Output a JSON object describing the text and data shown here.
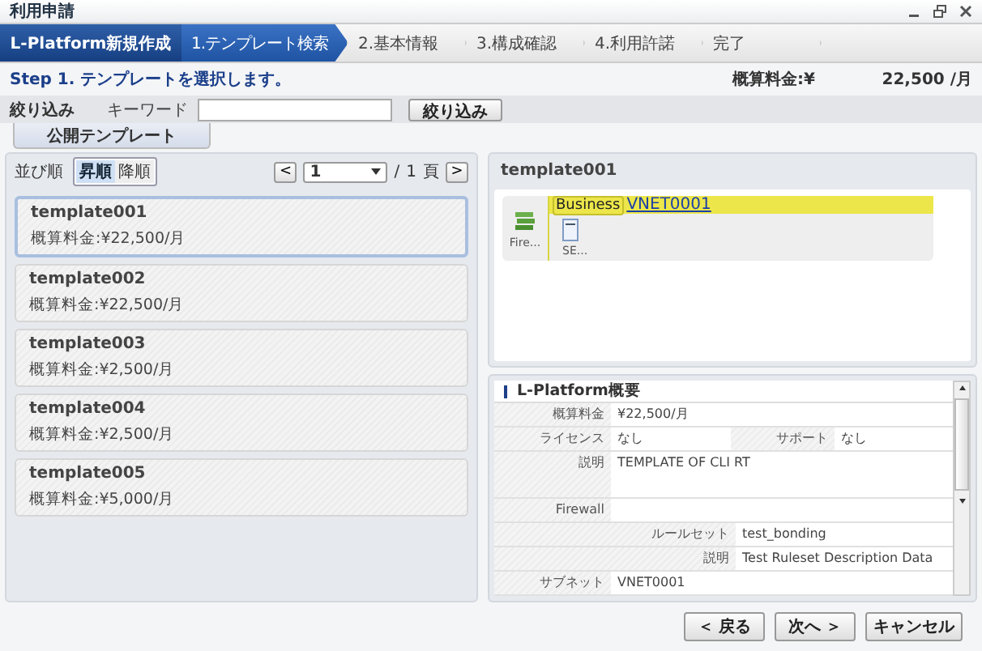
{
  "window": {
    "title": "利用申請"
  },
  "wizard": {
    "title": "L-Platform新規作成",
    "steps": [
      {
        "label": "1.テンプレート検索",
        "selected": true
      },
      {
        "label": "2.基本情報",
        "selected": false
      },
      {
        "label": "3.構成確認",
        "selected": false
      },
      {
        "label": "4.利用許諾",
        "selected": false
      },
      {
        "label": "完了",
        "selected": false
      }
    ]
  },
  "step_header": {
    "instruction": "Step 1. テンプレートを選択します。",
    "price_label": "概算料金:¥",
    "price_value": "22,500 /月"
  },
  "filter": {
    "label": "絞り込み",
    "keyword_label": "キーワード",
    "button": "絞り込み"
  },
  "tabs": [
    {
      "label": "公開テンプレート",
      "selected": true
    }
  ],
  "list_panel": {
    "sort_label": "並び順",
    "sort_options": [
      {
        "label": "昇順",
        "selected": true
      },
      {
        "label": "降順",
        "selected": false
      }
    ],
    "pager": {
      "prev": "<",
      "page": "1",
      "separator": "/",
      "total": "1",
      "unit": "頁",
      "next": ">"
    },
    "templates": [
      {
        "name": "template001",
        "price": "概算料金:¥22,500/月",
        "selected": true
      },
      {
        "name": "template002",
        "price": "概算料金:¥22,500/月",
        "selected": false
      },
      {
        "name": "template003",
        "price": "概算料金:¥2,500/月",
        "selected": false
      },
      {
        "name": "template004",
        "price": "概算料金:¥2,500/月",
        "selected": false
      },
      {
        "name": "template005",
        "price": "概算料金:¥5,000/月",
        "selected": false
      }
    ]
  },
  "preview": {
    "title": "template001",
    "firewall_label": "Fire...",
    "segment_label": "Business",
    "segment_link": "VNET0001",
    "server_label": "SE..."
  },
  "summary": {
    "title": "L-Platform概要",
    "rows": [
      {
        "kind": "wide",
        "label": "概算料金",
        "value": "¥22,500/月"
      },
      {
        "kind": "split",
        "label": "ライセンス",
        "value": "なし",
        "label2": "サポート",
        "value2": "なし"
      },
      {
        "kind": "tall",
        "label": "説明",
        "value": "TEMPLATE OF CLI RT"
      },
      {
        "kind": "section",
        "label": "Firewall"
      },
      {
        "kind": "sub",
        "label": "ルールセット",
        "value": "test_bonding"
      },
      {
        "kind": "sub",
        "label": "説明",
        "value": "Test Ruleset Description Data"
      },
      {
        "kind": "wide",
        "label": "サブネット",
        "value": "VNET0001"
      }
    ]
  },
  "buttons": [
    {
      "label": "＜ 戻る"
    },
    {
      "label": "次へ ＞"
    },
    {
      "label": "キャンセル"
    }
  ]
}
